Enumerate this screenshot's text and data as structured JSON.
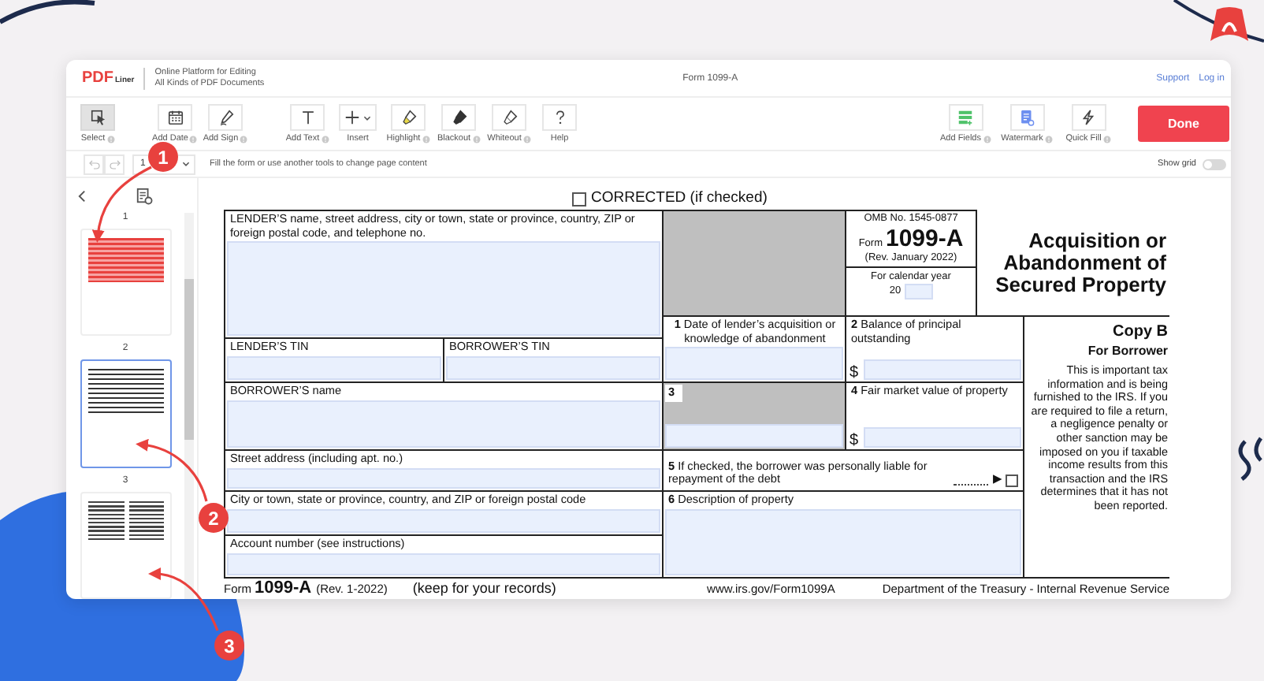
{
  "header": {
    "logo": {
      "brand": "PDF",
      "suffix": "Liner"
    },
    "tagline": [
      "Online Platform for Editing",
      "All Kinds of PDF Documents"
    ],
    "document_title": "Form 1099-A",
    "links": [
      "Support",
      "Log in"
    ]
  },
  "toolbar": {
    "tool_groups": [
      [
        {
          "kind": "select",
          "label": "Select",
          "selected": true,
          "info": true
        }
      ],
      [
        {
          "kind": "date",
          "label": "Add Date",
          "selected": false,
          "info": true
        },
        {
          "kind": "sign",
          "label": "Add Sign",
          "selected": false,
          "info": true
        }
      ],
      [
        {
          "kind": "text",
          "label": "Add Text",
          "selected": false,
          "info": true
        },
        {
          "kind": "insert",
          "label": "Insert",
          "selected": false,
          "info": false
        },
        {
          "kind": "highlight",
          "label": "Highlight",
          "selected": false,
          "info": true
        },
        {
          "kind": "blackout",
          "label": "Blackout",
          "selected": false,
          "info": true
        },
        {
          "kind": "whiteout",
          "label": "Whiteout",
          "selected": false,
          "info": true
        },
        {
          "kind": "help",
          "label": "Help",
          "selected": false,
          "info": false
        }
      ]
    ],
    "right_tools": [
      {
        "kind": "fields",
        "label": "Add Fields",
        "selected": false,
        "info": true
      },
      {
        "kind": "watermark",
        "label": "Watermark",
        "selected": false,
        "info": true
      },
      {
        "kind": "quickfill",
        "label": "Quick Fill",
        "selected": false,
        "info": true
      }
    ],
    "done_button": "Done"
  },
  "subbar": {
    "history": [
      {
        "kind": "undo",
        "disabled": true
      },
      {
        "kind": "redo",
        "disabled": true
      }
    ],
    "page_selector": "1",
    "hint": "Fill the form or use another tools to change page content",
    "show_grid": {
      "label": "Show grid",
      "on": false
    }
  },
  "sidebar": {
    "pages": [
      {
        "number": "1",
        "kind": "form-highlighted",
        "selected": false
      },
      {
        "number": "2",
        "kind": "form",
        "selected": true
      },
      {
        "number": "3",
        "kind": "text",
        "selected": false
      }
    ]
  },
  "form": {
    "corrected": {
      "label": "CORRECTED (if checked)",
      "checked": false
    },
    "lender_name": "LENDER’S name, street address, city or town, state or province, country, ZIP or foreign postal code, and telephone no.",
    "omb": "OMB No. 1545-0877",
    "form_word": "Form",
    "form_number": "1099-A",
    "revision": "(Rev. January 2022)",
    "calendar_label": "For calendar year",
    "year_prefix": "20",
    "title": "Acquisition or Abandonment of Secured Property",
    "box1": "**1** Date of lender’s acquisition or knowledge of abandonment",
    "box2": "**2** Balance of principal outstanding",
    "box2_currency": "$",
    "lender_tin": "LENDER’S TIN",
    "borrower_tin": "BORROWER’S TIN",
    "borrower_name": "BORROWER’S name",
    "box3": "3",
    "box4": "**4** Fair market value of property",
    "box4_currency": "$",
    "street": "Street address (including apt. no.)",
    "box5": {
      "text": "**5** If checked, the borrower was personally liable for repayment of the debt",
      "pointer": "▶",
      "checked": false
    },
    "city": "City or town, state or province, country, and ZIP or foreign postal code",
    "box6": "**6** Description of property",
    "account": "Account number (see instructions)",
    "copy": {
      "title": "Copy B",
      "subtitle": "For Borrower",
      "note": "This is important tax information and is being furnished to the IRS. If you are required to file a return, a negligence penalty or other sanction may be imposed on you if taxable income results from this transaction and the IRS determines that it has not been reported."
    },
    "footer": {
      "form_word": "Form",
      "form_number": "1099-A",
      "revision": "(Rev. 1-2022)",
      "keep": "(keep for your records)",
      "url": "www.irs.gov/Form1099A",
      "department": "Department of the Treasury - Internal Revenue Service"
    }
  },
  "callouts": [
    {
      "number": "1"
    },
    {
      "number": "2"
    },
    {
      "number": "3"
    }
  ]
}
